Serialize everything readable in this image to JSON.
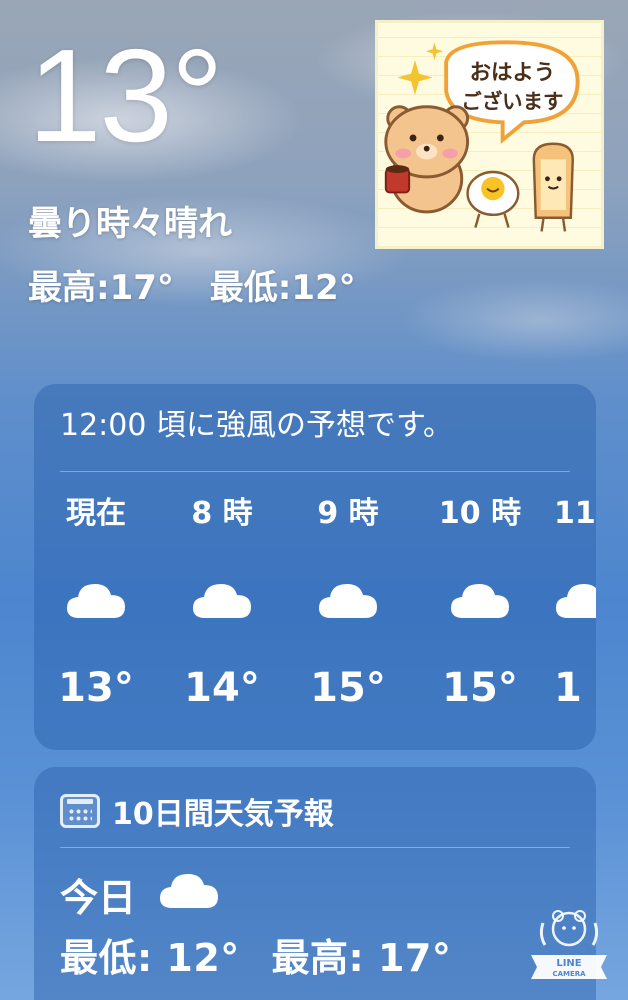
{
  "current": {
    "temperature": "13°",
    "condition": "曇り時々晴れ",
    "high": "最高:17°",
    "low": "最低:12°"
  },
  "sticker": {
    "text_line1": "おはよう",
    "text_line2": "ございます"
  },
  "hourly": {
    "alert": "12:00 頃に強風の予想です。",
    "items": [
      {
        "label": "現在",
        "icon": "cloud-icon",
        "temp": "13°"
      },
      {
        "label": "8 時",
        "icon": "cloud-icon",
        "temp": "14°"
      },
      {
        "label": "9 時",
        "icon": "cloud-icon",
        "temp": "15°"
      },
      {
        "label": "10 時",
        "icon": "cloud-icon",
        "temp": "15°"
      },
      {
        "label": "11",
        "icon": "cloud-icon",
        "temp": "1"
      }
    ]
  },
  "forecast": {
    "header": "10日間天気予報",
    "icon": "calendar-icon",
    "today": {
      "label": "今日",
      "icon": "cloud-icon",
      "low": "最低: 12°",
      "high": "最高: 17°"
    }
  },
  "watermark": {
    "line1": "LINE",
    "line2": "CAMERA"
  }
}
